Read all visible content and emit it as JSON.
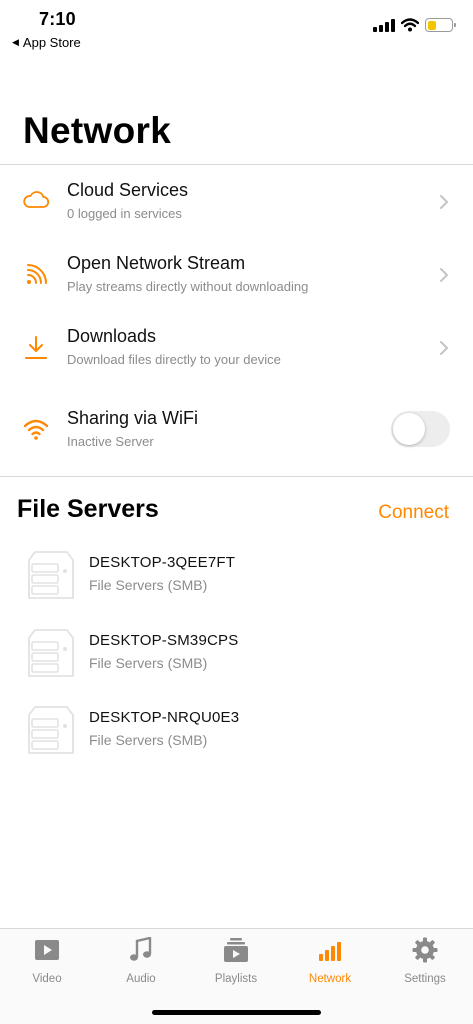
{
  "status_bar": {
    "time": "7:10",
    "back_label": "App Store"
  },
  "page": {
    "title": "Network"
  },
  "network_items": [
    {
      "icon": "cloud-icon",
      "title": "Cloud Services",
      "subtitle": "0 logged in services",
      "control": "chevron"
    },
    {
      "icon": "rss-icon",
      "title": "Open Network Stream",
      "subtitle": "Play streams directly without downloading",
      "control": "chevron"
    },
    {
      "icon": "download-icon",
      "title": "Downloads",
      "subtitle": "Download files directly to your device",
      "control": "chevron"
    },
    {
      "icon": "wifi-icon",
      "title": "Sharing via WiFi",
      "subtitle": "Inactive Server",
      "control": "toggle",
      "toggle_on": false
    }
  ],
  "file_servers": {
    "title": "File Servers",
    "connect_label": "Connect",
    "items": [
      {
        "icon": "server-icon",
        "name": "DESKTOP-3QEE7FT",
        "type": "File Servers (SMB)"
      },
      {
        "icon": "server-icon",
        "name": "DESKTOP-SM39CPS",
        "type": "File Servers (SMB)"
      },
      {
        "icon": "server-icon",
        "name": "DESKTOP-NRQU0E3",
        "type": "File Servers (SMB)"
      }
    ]
  },
  "tab_bar": {
    "tabs": [
      {
        "label": "Video",
        "icon": "video-icon",
        "active": false
      },
      {
        "label": "Audio",
        "icon": "music-note-icon",
        "active": false
      },
      {
        "label": "Playlists",
        "icon": "playlists-icon",
        "active": false
      },
      {
        "label": "Network",
        "icon": "network-bars-icon",
        "active": true
      },
      {
        "label": "Settings",
        "icon": "gear-icon",
        "active": false
      }
    ]
  },
  "colors": {
    "accent": "#ff8800",
    "secondary_text": "#8c8c8c",
    "inactive_tab": "#8a8a8a"
  }
}
